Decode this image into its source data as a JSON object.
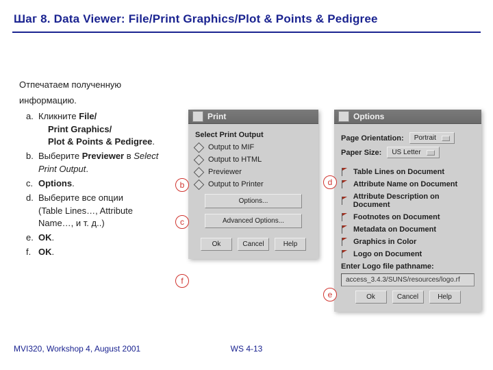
{
  "title": "Шаг 8.  Data Viewer:  File/Print Graphics/Plot & Points & Pedigree",
  "instructions": {
    "intro1": "Отпечатаем полученную",
    "intro2": "информацию.",
    "a_letter": "a.",
    "a_l1_pre": "Кликните ",
    "a_l1_b": "File/",
    "a_l2_b": "Print Graphics/",
    "a_l3_b": "Plot & Points & Pedigree",
    "a_l3_suffix": ".",
    "b_letter": "b.",
    "b_pre": "Выберите ",
    "b_bold": "Previewer",
    "b_mid": " в ",
    "b_ital": "Select Print Output",
    "b_suffix": ".",
    "c_letter": "c.",
    "c_bold": "Options",
    "c_suffix": ".",
    "d_letter": "d.",
    "d_l1": "Выберите все опции",
    "d_l2": "(Table Lines…, Attribute Name…, и т. д..)",
    "e_letter": "e.",
    "e_bold": "OK",
    "e_suffix": ".",
    "f_letter": "f.",
    "f_bold": "OK",
    "f_suffix": "."
  },
  "print": {
    "title": "Print",
    "group": "Select Print Output",
    "r1": "Output to MIF",
    "r2": "Output to HTML",
    "r3": "Previewer",
    "r4": "Output to Printer",
    "optionsBtn": "Options...",
    "advancedBtn": "Advanced Options...",
    "ok": "Ok",
    "cancel": "Cancel",
    "help": "Help"
  },
  "options": {
    "title": "Options",
    "orientationLabel": "Page Orientation:",
    "orientationValue": "Portrait",
    "paperLabel": "Paper Size:",
    "paperValue": "US Letter",
    "c1": "Table Lines on Document",
    "c2": "Attribute Name on Document",
    "c3": "Attribute Description on Document",
    "c4": "Footnotes on Document",
    "c5": "Metadata on Document",
    "c6": "Graphics in Color",
    "c7": "Logo on Document",
    "logoLabel": "Enter Logo file pathname:",
    "logoValue": "access_3.4.3/SUNS/resources/logo.rf",
    "ok": "Ok",
    "cancel": "Cancel",
    "help": "Help"
  },
  "callouts": {
    "b": "b",
    "c": "c",
    "d": "d",
    "e": "e",
    "f": "f"
  },
  "footer": {
    "left": "MVI320, Workshop 4, August 2001",
    "center": "WS 4-13"
  }
}
